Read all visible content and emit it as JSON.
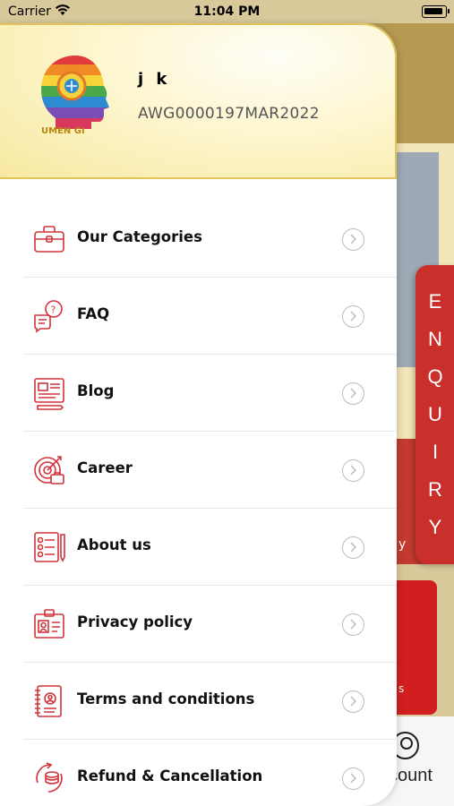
{
  "status_bar": {
    "carrier": "Carrier",
    "time": "11:04 PM"
  },
  "user": {
    "name": "j k",
    "id": "AWG0000197MAR2022",
    "logo_text": "UMEN GI"
  },
  "menu": [
    {
      "label": "Our Categories",
      "icon": "briefcase-icon"
    },
    {
      "label": "FAQ",
      "icon": "faq-chat-icon"
    },
    {
      "label": "Blog",
      "icon": "blog-icon"
    },
    {
      "label": "Career",
      "icon": "career-target-icon"
    },
    {
      "label": "About us",
      "icon": "about-list-icon"
    },
    {
      "label": "Privacy policy",
      "icon": "id-card-icon"
    },
    {
      "label": "Terms and conditions",
      "icon": "terms-book-icon"
    },
    {
      "label": "Refund & Cancellation",
      "icon": "refund-coins-icon"
    }
  ],
  "background": {
    "enquiry_letters": [
      "E",
      "N",
      "Q",
      "U",
      "I",
      "R",
      "Y"
    ],
    "card1_partial_text": "y",
    "card2_partial_text": "s",
    "account_label_partial": "count"
  },
  "colors": {
    "accent_red": "#c9302c",
    "header_gold": "#f7e9a2",
    "icon_red": "#d1343a"
  }
}
